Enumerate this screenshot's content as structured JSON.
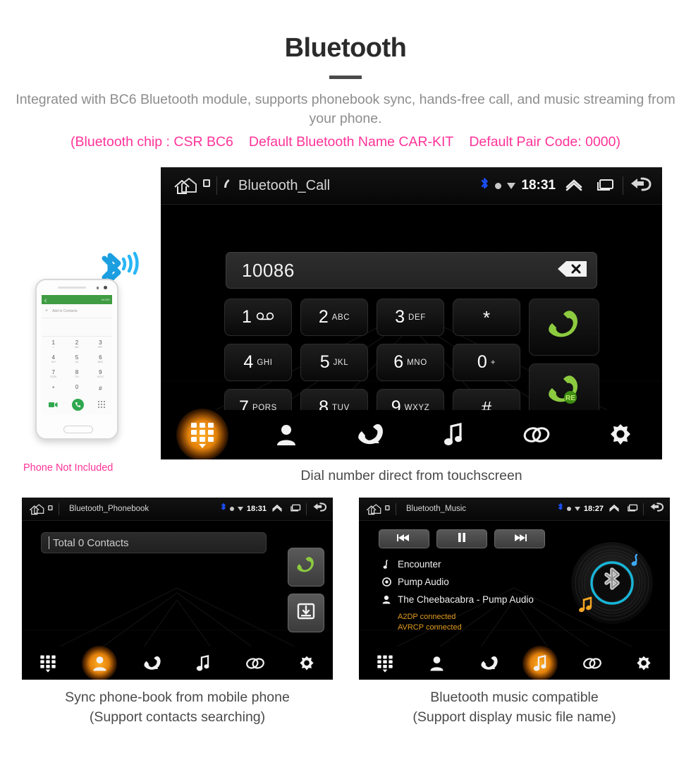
{
  "header": {
    "title": "Bluetooth",
    "subtitle": "Integrated with BC6 Bluetooth module, supports phonebook sync, hands-free call, and music streaming from your phone.",
    "pink_line": {
      "chip": "(Bluetooth chip : CSR BC6",
      "name": "Default Bluetooth Name CAR-KIT",
      "pair": "Default Pair Code: 0000)"
    },
    "pink_color": "#ff3399",
    "subtitle_color": "#8d8d8d"
  },
  "call_screen": {
    "status": {
      "title": "Bluetooth_Call",
      "clock": "18:31",
      "home_icon": "home-icon",
      "bluetooth_icon": "bluetooth-icon",
      "chevron_icon": "chevron-up-icon",
      "recents_icon": "recents-icon",
      "back_icon": "back-icon"
    },
    "dial_value": "10086",
    "backspace_icon": "backspace-icon",
    "keys": [
      {
        "digit": "1",
        "letters": "",
        "glyph": "voicemail"
      },
      {
        "digit": "2",
        "letters": "ABC",
        "glyph": ""
      },
      {
        "digit": "3",
        "letters": "DEF",
        "glyph": ""
      },
      {
        "digit": "*",
        "letters": "",
        "glyph": "symbol"
      },
      {
        "digit": "4",
        "letters": "GHI",
        "glyph": ""
      },
      {
        "digit": "5",
        "letters": "JKL",
        "glyph": ""
      },
      {
        "digit": "6",
        "letters": "MNO",
        "glyph": ""
      },
      {
        "digit": "0",
        "letters": "+",
        "glyph": ""
      },
      {
        "digit": "7",
        "letters": "PQRS",
        "glyph": ""
      },
      {
        "digit": "8",
        "letters": "TUV",
        "glyph": ""
      },
      {
        "digit": "9",
        "letters": "WXYZ",
        "glyph": ""
      },
      {
        "digit": "#",
        "letters": "",
        "glyph": "symbol"
      }
    ],
    "call_button": "call-icon",
    "redial_button": "redial-icon",
    "redial_badge": "RE",
    "accent_green": "#8ccb3f",
    "nav": [
      {
        "name": "keypad",
        "active": true
      },
      {
        "name": "contacts",
        "active": false
      },
      {
        "name": "call-history",
        "active": false
      },
      {
        "name": "music",
        "active": false
      },
      {
        "name": "link",
        "active": false
      },
      {
        "name": "settings",
        "active": false
      }
    ],
    "caption": "Dial number direct from touchscreen"
  },
  "phonebook_screen": {
    "status": {
      "title": "Bluetooth_Phonebook",
      "clock": "18:31"
    },
    "search_value": "Total 0 Contacts",
    "call_button": "call-icon",
    "download_button": "download-contacts-icon",
    "nav": [
      {
        "name": "keypad",
        "active": false
      },
      {
        "name": "contacts",
        "active": true
      },
      {
        "name": "call-history",
        "active": false
      },
      {
        "name": "music",
        "active": false
      },
      {
        "name": "link",
        "active": false
      },
      {
        "name": "settings",
        "active": false
      }
    ],
    "caption_line1": "Sync phone-book from mobile phone",
    "caption_line2": "(Support contacts searching)"
  },
  "music_screen": {
    "status": {
      "title": "Bluetooth_Music",
      "clock": "18:27"
    },
    "transport": [
      {
        "name": "previous",
        "icon": "skip-back-icon"
      },
      {
        "name": "pause",
        "icon": "pause-icon"
      },
      {
        "name": "next",
        "icon": "skip-forward-icon"
      }
    ],
    "track_title": "Encounter",
    "album": "Pump Audio",
    "artist": "The Cheebacabra - Pump Audio",
    "status_a2dp": "A2DP connected",
    "status_avrcp": "AVRCP connected",
    "status_color": "#e39b1e",
    "disc_accent": "#17b6d8",
    "nav": [
      {
        "name": "keypad",
        "active": false
      },
      {
        "name": "contacts",
        "active": false
      },
      {
        "name": "call-history",
        "active": false
      },
      {
        "name": "music",
        "active": true
      },
      {
        "name": "link",
        "active": false
      },
      {
        "name": "settings",
        "active": false
      }
    ],
    "caption_line1": "Bluetooth music compatible",
    "caption_line2": "(Support display music file name)"
  },
  "phone_mockup": {
    "note": "Phone Not Included",
    "topbar_more": "MORE",
    "add_contacts": "Add to Contacts",
    "keys": [
      {
        "d": "1",
        "s": "∞"
      },
      {
        "d": "2",
        "s": "ABC"
      },
      {
        "d": "3",
        "s": "DEF"
      },
      {
        "d": "4",
        "s": "GHI"
      },
      {
        "d": "5",
        "s": "JKL"
      },
      {
        "d": "6",
        "s": "MNO"
      },
      {
        "d": "7",
        "s": "PQRS"
      },
      {
        "d": "8",
        "s": "TUV"
      },
      {
        "d": "9",
        "s": "WXYZ"
      },
      {
        "d": "*",
        "s": ""
      },
      {
        "d": "0",
        "s": "+"
      },
      {
        "d": "#",
        "s": ""
      }
    ]
  }
}
